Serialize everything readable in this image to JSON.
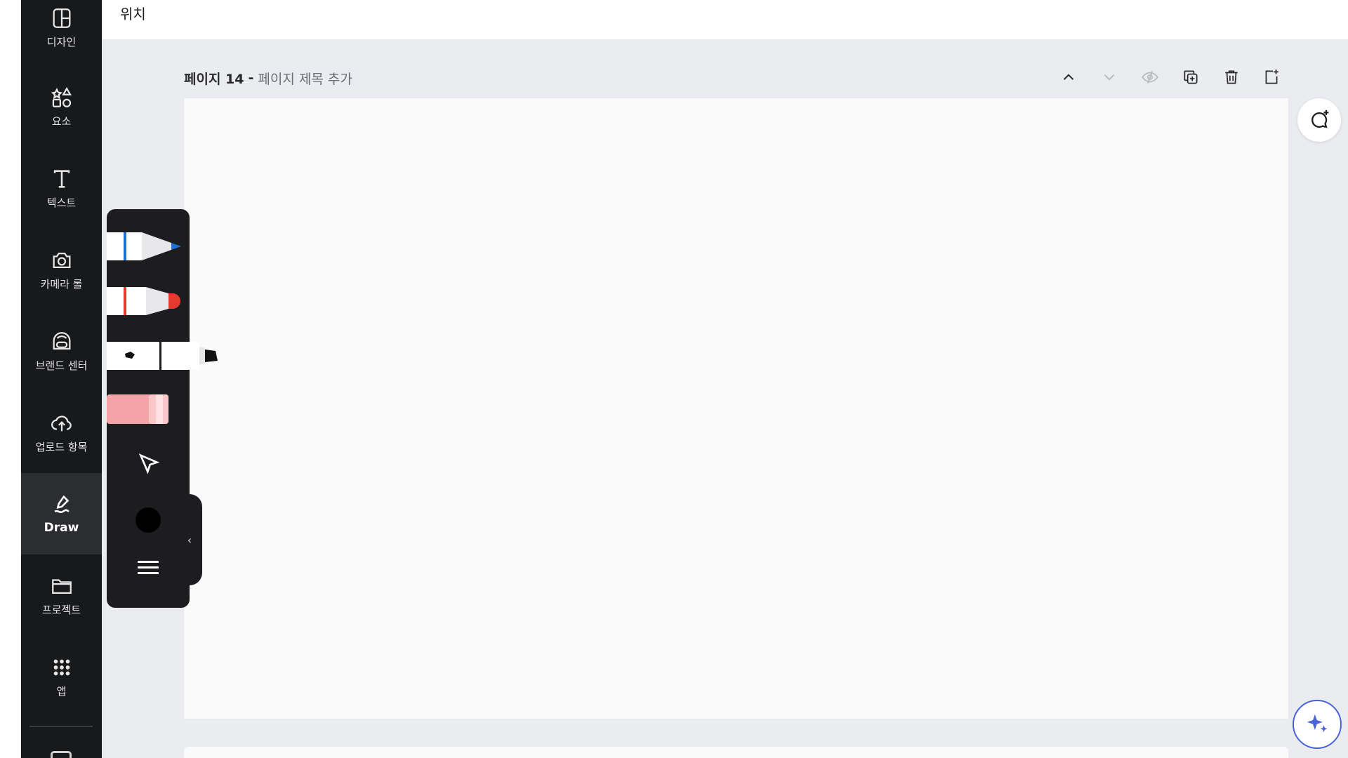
{
  "topbar": {
    "title": "위치"
  },
  "sidebar": {
    "items": [
      {
        "label": "디자인",
        "icon": "layout-icon"
      },
      {
        "label": "요소",
        "icon": "shapes-icon"
      },
      {
        "label": "텍스트",
        "icon": "text-icon"
      },
      {
        "label": "카메라 롤",
        "icon": "camera-icon"
      },
      {
        "label": "브랜드 센터",
        "icon": "brand-center-icon"
      },
      {
        "label": "업로드 항목",
        "icon": "cloud-upload-icon"
      },
      {
        "label": "Draw",
        "icon": "draw-icon",
        "active": true
      },
      {
        "label": "프로젝트",
        "icon": "folder-icon"
      },
      {
        "label": "앱",
        "icon": "apps-grid-icon"
      }
    ]
  },
  "page": {
    "label": "페이지 14",
    "separator": "-",
    "title_placeholder": "페이지 제목 추가"
  },
  "draw_tools": {
    "pens": [
      {
        "name": "pen",
        "color": "#1f6fd6"
      },
      {
        "name": "marker",
        "color": "#e53a2e"
      },
      {
        "name": "highlighter",
        "color": "#000000"
      },
      {
        "name": "eraser",
        "color": "#f4a3a8"
      }
    ],
    "selected_color": "#000000",
    "collapse_glyph": "‹"
  },
  "colors": {
    "sidebar_bg": "#18191b",
    "workspace_bg": "#ebecf0",
    "canvas_bg": "#fafafb",
    "accent": "#4a63d8"
  }
}
